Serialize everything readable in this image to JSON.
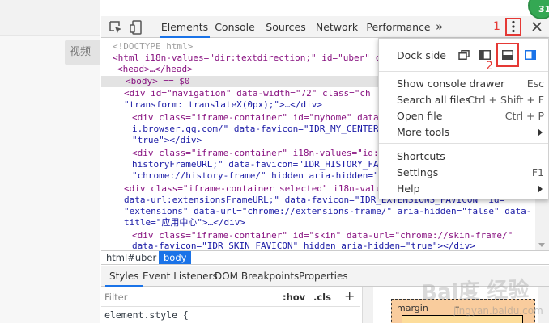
{
  "page": {
    "side_button_label": "视频"
  },
  "badge": {
    "text": "31"
  },
  "toolbar": {
    "tabs": [
      {
        "label": "Elements",
        "active": true
      },
      {
        "label": "Console",
        "active": false
      },
      {
        "label": "Sources",
        "active": false
      },
      {
        "label": "Network",
        "active": false
      },
      {
        "label": "Performance",
        "active": false
      }
    ],
    "more_tabs": "»",
    "marker_1": "1"
  },
  "menu": {
    "dock_label": "Dock side",
    "marker_2": "2",
    "items": [
      {
        "label": "Show console drawer",
        "shortcut": "Esc"
      },
      {
        "label": "Search all files",
        "shortcut": "Ctrl + Shift + F"
      },
      {
        "label": "Open file",
        "shortcut": "Ctrl + P"
      },
      {
        "label": "More tools",
        "shortcut": ""
      },
      {
        "label": "Shortcuts",
        "shortcut": ""
      },
      {
        "label": "Settings",
        "shortcut": "F1"
      },
      {
        "label": "Help",
        "shortcut": ""
      }
    ]
  },
  "elements": {
    "lines": [
      {
        "t": "<!DOCTYPE html>"
      },
      {
        "t": "<html i18n-values=\"dir:textdirection;\" id=\"uber\" c"
      },
      {
        "t": "<head>…</head>"
      },
      {
        "t": "<body> == $0"
      },
      {
        "t": "<div id=\"navigation\" data-width=\"72\" class=\"ch"
      },
      {
        "t": "\"transform: translateX(0px);\">…</div>"
      },
      {
        "t": "<div class=\"iframe-container\" id=\"myhome\" data"
      },
      {
        "t": "i.browser.qq.com/\" data-favicon=\"IDR_MY_CENTER"
      },
      {
        "t": "\"true\"></div>"
      },
      {
        "t": "<div class=\"iframe-container\" i18n-values=\"id:"
      },
      {
        "t": "historyFrameURL;\" data-favicon=\"IDR_HISTORY_FA"
      },
      {
        "t": "\"chrome://history-frame/\" hidden aria-hidden=\""
      },
      {
        "t": "<div class=\"iframe-container selected\" i18n-valu"
      },
      {
        "t": "data-url:extensionsFrameURL;\" data-favicon=\"IDR_EXTENSIONS_FAVICON\" id="
      },
      {
        "t": "\"extensions\" data-url=\"chrome://extensions-frame/\" aria-hidden=\"false\" data-"
      },
      {
        "t": "title=\"应用中心\">…</div>"
      },
      {
        "t": "<div class=\"iframe-container\" id=\"skin\" data-url=\"chrome://skin-frame/\""
      },
      {
        "t": "data-favicon=\"IDR_SKIN_FAVICON\" hidden aria-hidden=\"true\"></div>"
      }
    ]
  },
  "breadcrumb": {
    "items": [
      "html#uber",
      "body"
    ]
  },
  "styles": {
    "tabs": [
      "Styles",
      "Event Listeners",
      "DOM Breakpoints",
      "Properties"
    ],
    "filter_placeholder": "Filter",
    "hov": ":hov",
    "cls": ".cls",
    "add": "+",
    "element_style": "element.style {"
  },
  "boxmodel": {
    "margin_label": "margin",
    "margin_value": "–"
  },
  "watermark": {
    "text": "Bai度 经验",
    "url": "jingyan.baidu.com"
  },
  "colors": {
    "accent": "#1a73e8",
    "marker": "#e53935"
  }
}
